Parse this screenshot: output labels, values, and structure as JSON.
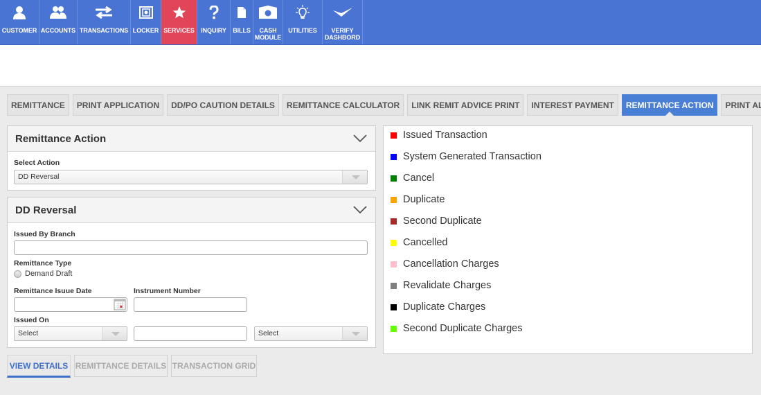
{
  "nav": {
    "items": [
      {
        "label": "CUSTOMER",
        "icon": "person-icon"
      },
      {
        "label": "ACCOUNTS",
        "icon": "users-icon"
      },
      {
        "label": "TRANSACTIONS",
        "icon": "arrows-icon"
      },
      {
        "label": "LOCKER",
        "icon": "safe-icon"
      },
      {
        "label": "SERVICES",
        "icon": "star-icon",
        "active": true
      },
      {
        "label": "INQUIRY",
        "icon": "question-icon"
      },
      {
        "label": "BILLS",
        "icon": "document-icon"
      },
      {
        "label_line1": "CASH",
        "label_line2": "MODULE",
        "icon": "cash-icon"
      },
      {
        "label": "UTILITIES",
        "icon": "lightbulb-icon"
      },
      {
        "label_line1": "VERIFY",
        "label_line2": "DASHBORD",
        "icon": "check-icon"
      }
    ],
    "active_color": "#e0455a",
    "bar_color": "#4a74d4"
  },
  "tabs": [
    {
      "label": "REMITTANCE"
    },
    {
      "label": "PRINT APPLICATION"
    },
    {
      "label": "DD/PO CAUTION DETAILS"
    },
    {
      "label": "REMITTANCE CALCULATOR"
    },
    {
      "label": "LINK REMIT ADVICE PRINT"
    },
    {
      "label": "INTEREST PAYMENT"
    },
    {
      "label": "REMITTANCE ACTION",
      "active": true
    },
    {
      "label": "PRINT ALL"
    }
  ],
  "remittance_action": {
    "title": "Remittance Action",
    "select_label": "Select Action",
    "select_value": "DD Reversal"
  },
  "dd_reversal": {
    "title": "DD Reversal",
    "issued_by_branch_label": "Issued By Branch",
    "issued_by_branch_value": "",
    "remittance_type_label": "Remittance Type",
    "remittance_type_option": "Demand Draft",
    "issue_date_label": "Remittance Isuue Date",
    "issue_date_value": "",
    "instrument_number_label": "Instrument Number",
    "instrument_number_value": "",
    "issued_on_label": "Issued On",
    "issued_on_select1": "Select",
    "issued_on_input": "",
    "issued_on_select2": "Select"
  },
  "buttons": {
    "view_details": "VIEW DETAILS",
    "remittance_details": "REMITTANCE DETAILS",
    "transaction_grid": "TRANSACTION GRID"
  },
  "legend": [
    {
      "label": "Issued Transaction",
      "color": "#ff0000"
    },
    {
      "label": "System Generated Transaction",
      "color": "#0000ff"
    },
    {
      "label": "Cancel",
      "color": "#008000"
    },
    {
      "label": "Duplicate",
      "color": "#ffa500"
    },
    {
      "label": "Second Duplicate",
      "color": "#a52a2a"
    },
    {
      "label": "Cancelled",
      "color": "#ffff00"
    },
    {
      "label": "Cancellation Charges",
      "color": "#ffc0cb"
    },
    {
      "label": "Revalidate Charges",
      "color": "#808080"
    },
    {
      "label": "Duplicate Charges",
      "color": "#000000"
    },
    {
      "label": "Second Duplicate Charges",
      "color": "#66ff00"
    }
  ]
}
